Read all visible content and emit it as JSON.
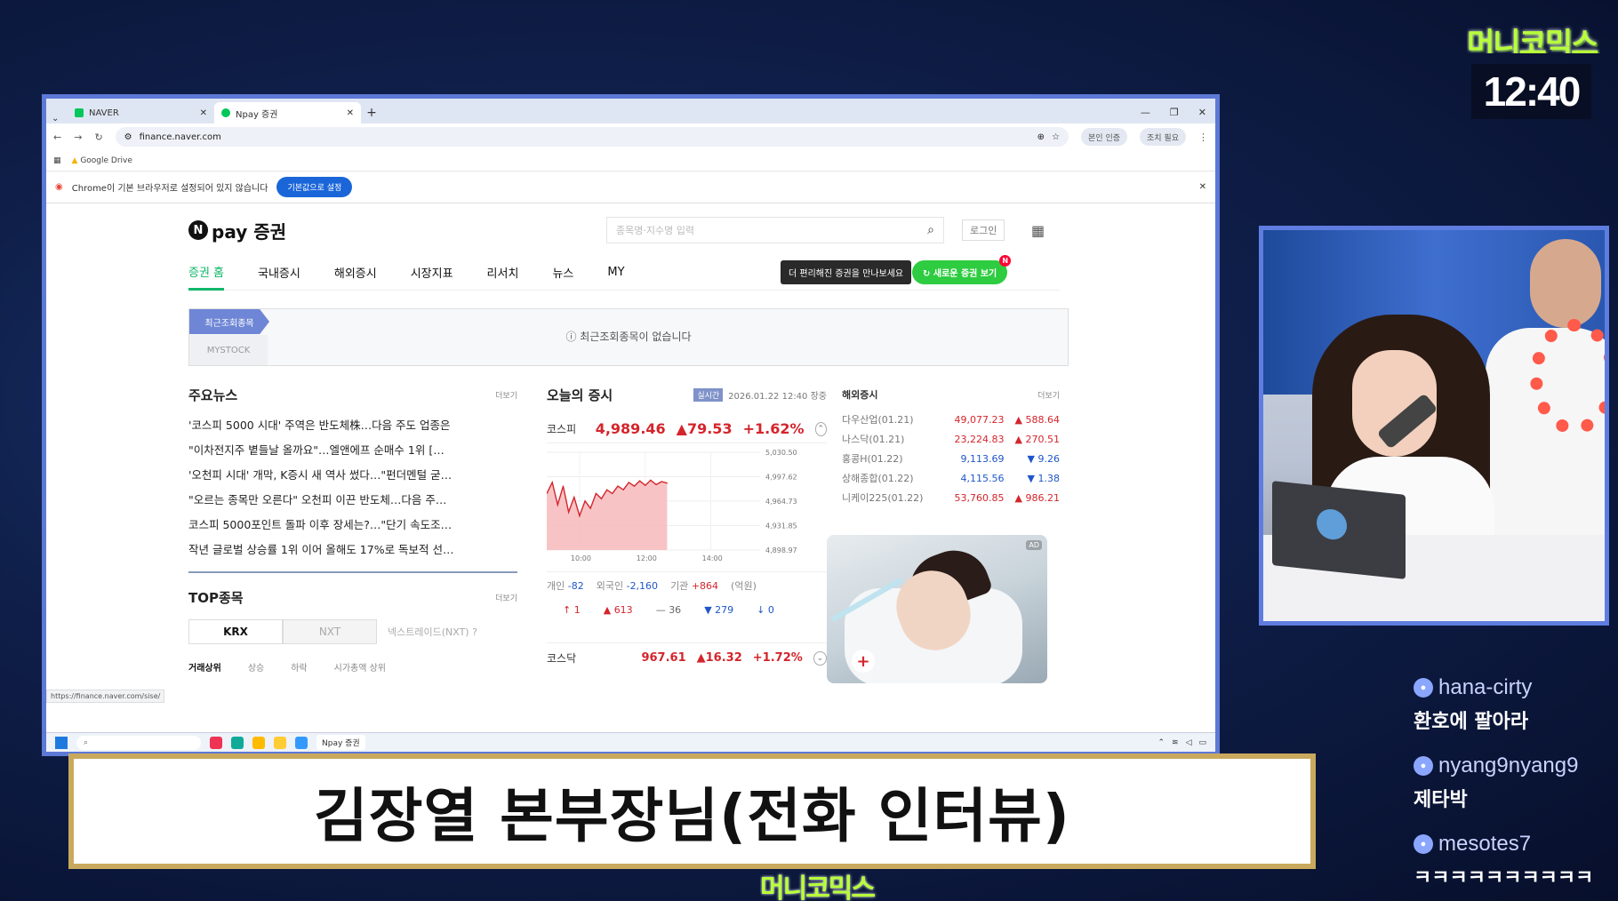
{
  "overlay": {
    "brand": "머니코믹스",
    "clock": "12:40",
    "subtitle": "김장열 본부장님(전화 인터뷰)",
    "chat": [
      {
        "user": "hana-cirty",
        "text": "환호에 팔아라"
      },
      {
        "user": "nyang9nyang9",
        "text": "제타박"
      },
      {
        "user": "mesotes7",
        "text": "ㅋㅋㅋㅋㅋㅋㅋㅋㅋㅋ"
      }
    ]
  },
  "browser": {
    "tabs": [
      {
        "label": "NAVER",
        "active": false
      },
      {
        "label": "Npay 증권",
        "active": true
      }
    ],
    "url": "finance.naver.com",
    "profile_pill": "본인 인증",
    "extra_pill": "조치 필요",
    "bookmark": "Google Drive",
    "infobar_text": "Chrome이 기본 브라우저로 설정되어 있지 않습니다",
    "infobar_button": "기본값으로 설정",
    "status_url": "https://finance.naver.com/sise/"
  },
  "site": {
    "logo_text": "pay 증권",
    "search_placeholder": "종목명·지수명 입력",
    "login": "로그인",
    "nav": [
      "증권 홈",
      "국내증시",
      "해외증시",
      "시장지표",
      "리서치",
      "뉴스",
      "MY"
    ],
    "promo": "더 편리해진 증권을 만나보세요",
    "green_button": "새로운 증권 보기",
    "recent": {
      "tab1": "최근조회종목",
      "tab2": "MYSTOCK",
      "empty": "최근조회종목이 없습니다"
    },
    "news": {
      "title": "주요뉴스",
      "more": "더보기",
      "items": [
        "'코스피 5000 시대' 주역은 반도체株…다음 주도 업종은",
        "\"이차전지주 볕들날 올까요\"…엘앤에프 순매수 1위 […",
        "'오천피 시대' 개막, K증시 새 역사 썼다…\"펀더멘털 굳…",
        "\"오르는 종목만 오른다\" 오천피 이끈 반도체…다음 주…",
        "코스피 5000포인트 돌파 이후 장세는?…\"단기 속도조…",
        "작년 글로벌 상승률 1위 이어 올해도 17%로 독보적 선…"
      ]
    },
    "top": {
      "title": "TOP종목",
      "more": "더보기",
      "seg": [
        "KRX",
        "NXT"
      ],
      "nxt_note": "넥스트레이드(NXT) ?",
      "tabs": [
        "거래상위",
        "상승",
        "하락",
        "시가총액 상위"
      ]
    },
    "market": {
      "title": "오늘의 증시",
      "realtime": "실시간",
      "timestamp": "2026.01.22 12:40 장중",
      "kospi": {
        "name": "코스피",
        "value": "4,989.46",
        "change": "▲79.53",
        "pct": "+1.62%"
      },
      "investors": {
        "individual_label": "개인",
        "individual": "-82",
        "foreign_label": "외국인",
        "foreign": "-2,160",
        "inst_label": "기관",
        "inst": "+864",
        "unit": "(억원)"
      },
      "breadth": {
        "limit_up": "1",
        "up": "613",
        "flat": "36",
        "down": "279",
        "limit_down": "0"
      },
      "kosdaq": {
        "name": "코스닥",
        "value": "967.61",
        "change": "▲16.32",
        "pct": "+1.72%"
      }
    },
    "world": {
      "title": "해외증시",
      "more": "더보기",
      "rows": [
        {
          "name": "다우산업(01.21)",
          "value": "49,077.23",
          "change": "▲ 588.64",
          "dir": "up"
        },
        {
          "name": "나스닥(01.21)",
          "value": "23,224.83",
          "change": "▲ 270.51",
          "dir": "up"
        },
        {
          "name": "홍콩H(01.22)",
          "value": "9,113.69",
          "change": "▼ 9.26",
          "dir": "down"
        },
        {
          "name": "상해종합(01.22)",
          "value": "4,115.56",
          "change": "▼ 1.38",
          "dir": "down"
        },
        {
          "name": "니케이225(01.22)",
          "value": "53,760.85",
          "change": "▲ 986.21",
          "dir": "up"
        }
      ],
      "ad_tag": "AD"
    }
  },
  "chart_data": {
    "type": "area",
    "title": "코스피",
    "x_ticks": [
      "10:00",
      "12:00",
      "14:00"
    ],
    "y_ticks": [
      "5,030.50",
      "4,997.62",
      "4,964.73",
      "4,931.85",
      "4,898.97"
    ],
    "ylim": [
      4898.97,
      5030.5
    ],
    "x_range": [
      "09:00",
      "15:30"
    ],
    "series": [
      {
        "values": [
          {
            "t": "09:00",
            "v": 4975
          },
          {
            "t": "09:10",
            "v": 4990
          },
          {
            "t": "09:20",
            "v": 4960
          },
          {
            "t": "09:30",
            "v": 4985
          },
          {
            "t": "09:40",
            "v": 4950
          },
          {
            "t": "09:50",
            "v": 4970
          },
          {
            "t": "10:00",
            "v": 4945
          },
          {
            "t": "10:10",
            "v": 4965
          },
          {
            "t": "10:20",
            "v": 4955
          },
          {
            "t": "10:30",
            "v": 4975
          },
          {
            "t": "10:40",
            "v": 4968
          },
          {
            "t": "10:50",
            "v": 4980
          },
          {
            "t": "11:00",
            "v": 4975
          },
          {
            "t": "11:10",
            "v": 4985
          },
          {
            "t": "11:20",
            "v": 4980
          },
          {
            "t": "11:30",
            "v": 4990
          },
          {
            "t": "11:40",
            "v": 4985
          },
          {
            "t": "11:50",
            "v": 4992
          },
          {
            "t": "12:00",
            "v": 4986
          },
          {
            "t": "12:10",
            "v": 4993
          },
          {
            "t": "12:20",
            "v": 4987
          },
          {
            "t": "12:30",
            "v": 4991
          },
          {
            "t": "12:40",
            "v": 4989
          }
        ]
      }
    ],
    "grid": true
  },
  "icons": {
    "search": "search-icon",
    "grid": "apps-grid-icon",
    "refresh": "refresh-icon"
  }
}
